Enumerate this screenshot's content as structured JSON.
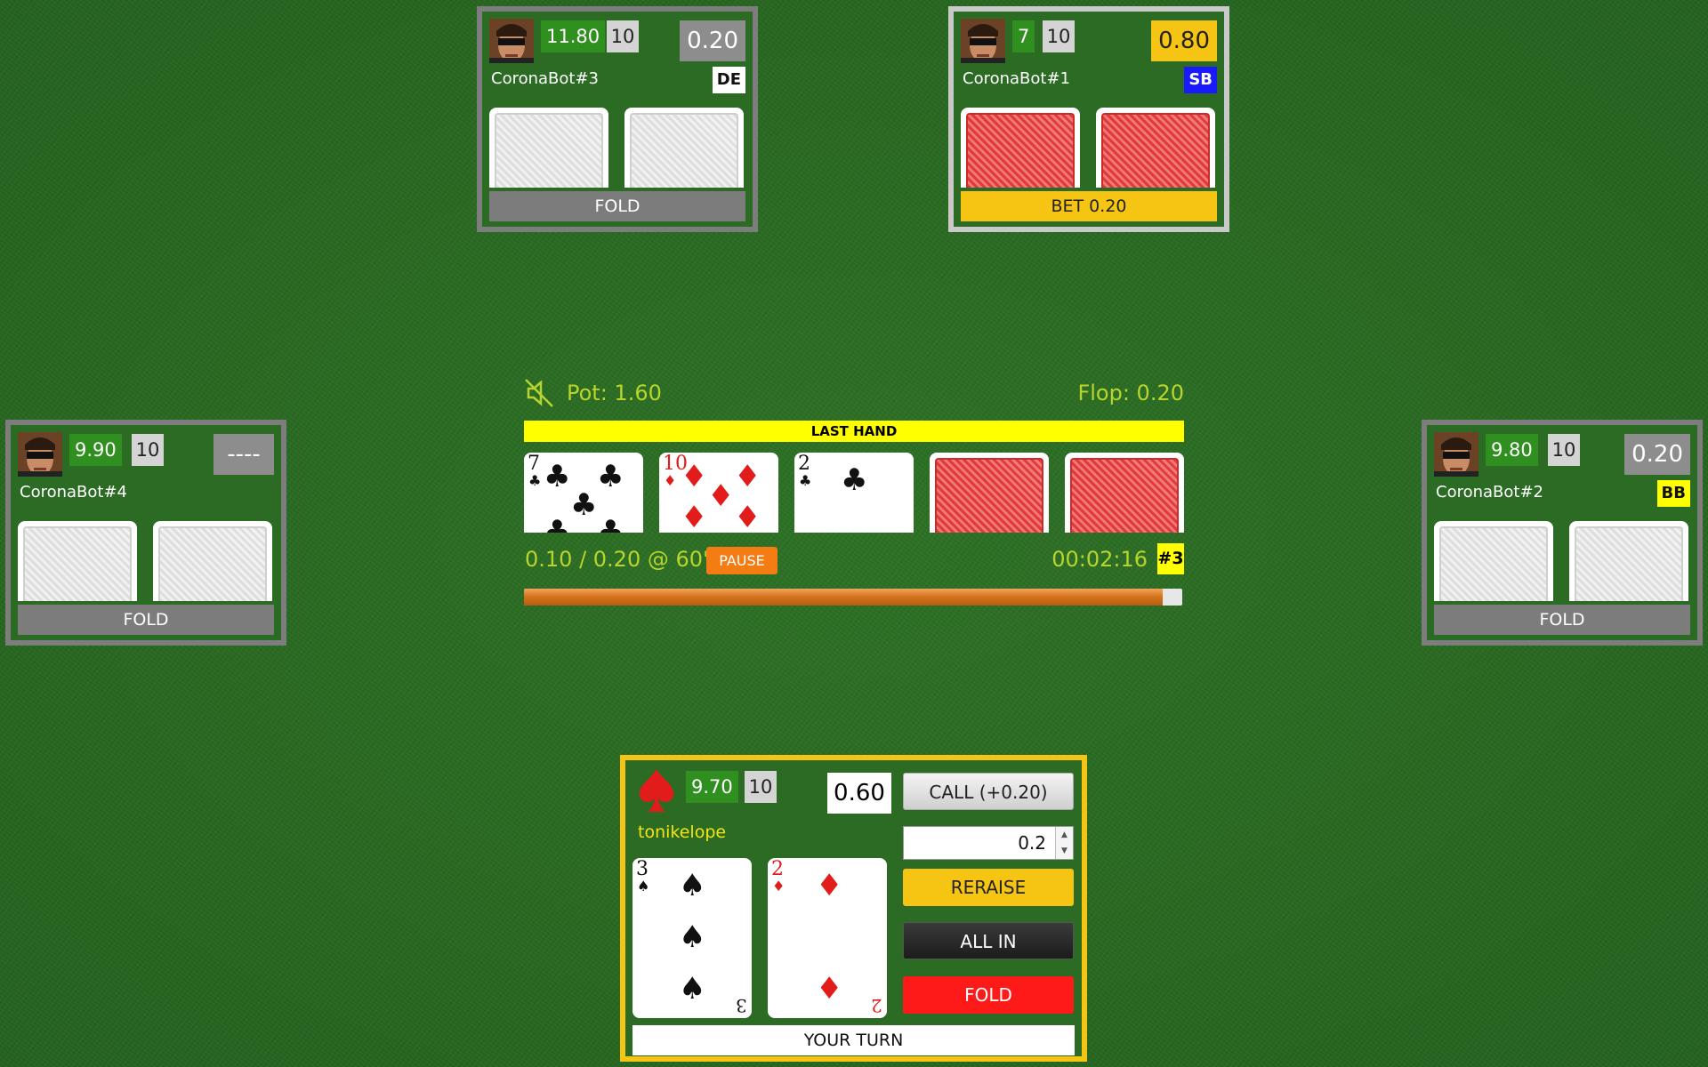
{
  "seats": {
    "p3": {
      "stack": "11.80",
      "level": "10",
      "bet": "0.20",
      "name": "CoronaBot#3",
      "badge": "DE",
      "status": "FOLD",
      "badge_color": "#ffffff"
    },
    "p1": {
      "stack": "7",
      "level": "10",
      "bet": "0.80",
      "name": "CoronaBot#1",
      "badge": "SB",
      "status": "BET 0.20",
      "badge_color": "#1a1aff"
    },
    "p4": {
      "stack": "9.90",
      "level": "10",
      "bet": "----",
      "name": "CoronaBot#4",
      "status": "FOLD"
    },
    "p2": {
      "stack": "9.80",
      "level": "10",
      "bet": "0.20",
      "name": "CoronaBot#2",
      "badge": "BB",
      "status": "FOLD",
      "badge_color": "#ffff00"
    }
  },
  "board": {
    "pot": "Pot: 1.60",
    "street": "Flop: 0.20",
    "banner": "LAST HAND",
    "cards": [
      {
        "rank": "7",
        "suit": "♣",
        "color": "black"
      },
      {
        "rank": "10",
        "suit": "♦",
        "color": "red"
      },
      {
        "rank": "2",
        "suit": "♣",
        "color": "black"
      }
    ],
    "blinds": "0.10 / 0.20 @ 60'",
    "pause_label": "PAUSE",
    "clock": "00:02:16",
    "hand_number": "#3",
    "progress_fraction": 0.97
  },
  "hero": {
    "stack": "9.70",
    "level": "10",
    "bet": "0.60",
    "name": "tonikelope",
    "cards": [
      {
        "rank": "3",
        "suit": "♠",
        "color": "black"
      },
      {
        "rank": "2",
        "suit": "♦",
        "color": "red"
      }
    ],
    "call_label": "CALL (+0.20)",
    "raise_amount": "0.2",
    "reraise_label": "RERAISE",
    "allin_label": "ALL IN",
    "fold_label": "FOLD",
    "status": "YOUR TURN"
  },
  "icons": {
    "mute": "speaker-muted-icon",
    "hero_suit": "spade-icon",
    "avatar": "terminator-avatar"
  },
  "colors": {
    "felt": "#2a6a22",
    "stack_green": "#2f8f1f",
    "highlight_yellow": "#f6c413",
    "fold_red": "#ff1a1a",
    "pause_orange": "#f37c13"
  }
}
